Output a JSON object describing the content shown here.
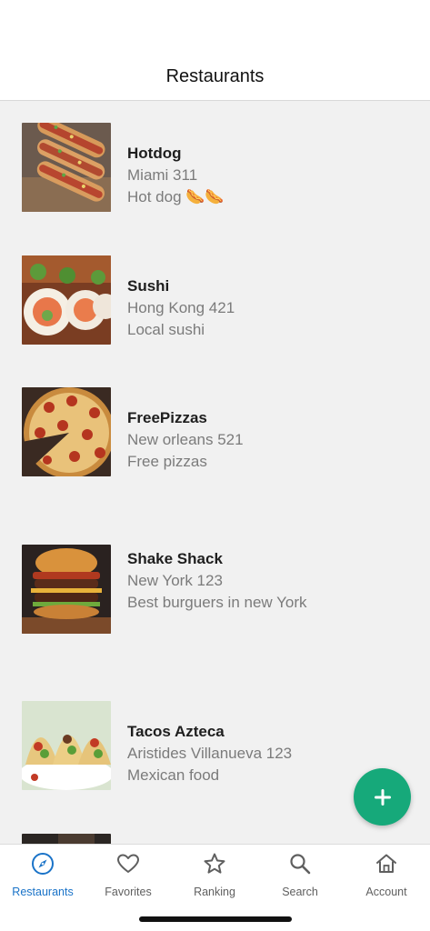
{
  "header": {
    "title": "Restaurants"
  },
  "restaurants": [
    {
      "name": "Hotdog",
      "address": "Miami 311",
      "description": "Hot dog 🌭🌭",
      "image": "hotdog-photo"
    },
    {
      "name": "Sushi",
      "address": "Hong Kong 421",
      "description": "Local sushi",
      "image": "sushi-photo"
    },
    {
      "name": "FreePizzas",
      "address": "New orleans 521",
      "description": "Free pizzas",
      "image": "pizza-photo"
    },
    {
      "name": "Shake Shack",
      "address": "New York 123",
      "description": "Best burguers in new York",
      "image": "burger-photo"
    },
    {
      "name": "Tacos Azteca",
      "address": "Aristides Villanueva 123",
      "description": "Mexican food",
      "image": "tacos-photo"
    }
  ],
  "fab": {
    "icon": "plus-icon",
    "color": "#16a97a"
  },
  "tabs": [
    {
      "label": "Restaurants",
      "icon": "compass-icon",
      "active": true
    },
    {
      "label": "Favorites",
      "icon": "heart-icon",
      "active": false
    },
    {
      "label": "Ranking",
      "icon": "star-icon",
      "active": false
    },
    {
      "label": "Search",
      "icon": "search-icon",
      "active": false
    },
    {
      "label": "Account",
      "icon": "home-icon",
      "active": false
    }
  ],
  "colors": {
    "accent": "#1a73c8",
    "fab": "#16a97a",
    "list_background": "#f1f1f1"
  }
}
